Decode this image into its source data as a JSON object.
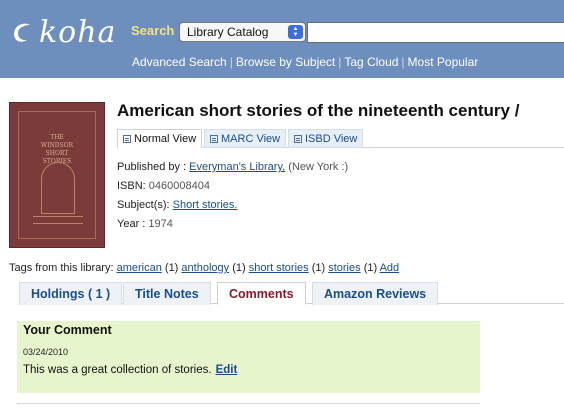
{
  "header": {
    "logo_text": "koha",
    "search_label": "Search",
    "catalog_selected": "Library Catalog",
    "search_value": "",
    "links": [
      {
        "label": "Advanced Search"
      },
      {
        "label": "Browse by Subject"
      },
      {
        "label": "Tag Cloud"
      },
      {
        "label": "Most Popular"
      }
    ],
    "colors": {
      "bar": "#6e8fbd",
      "search_label": "#f2e27a"
    }
  },
  "record": {
    "title": "American short stories of the nineteenth century /",
    "cover_text_lines": [
      "THE",
      "WINDSOR",
      "SHORT",
      "STORIES"
    ],
    "view_tabs": [
      {
        "label": "Normal View",
        "active": true
      },
      {
        "label": "MARC View",
        "active": false
      },
      {
        "label": "ISBD View",
        "active": false
      }
    ],
    "published_label": "Published by :",
    "publisher": "Everyman's Library,",
    "place": "(New York :)",
    "isbn_label": "ISBN:",
    "isbn": "0460008404",
    "subjects_label": "Subject(s):",
    "subject": "Short stories.",
    "year_label": "Year :",
    "year": "1974"
  },
  "tags": {
    "intro": "Tags from this library:",
    "items": [
      {
        "name": "american",
        "count": "(1)"
      },
      {
        "name": "anthology",
        "count": "(1)"
      },
      {
        "name": "short stories",
        "count": "(1)"
      },
      {
        "name": "stories",
        "count": "(1)"
      }
    ],
    "add_label": "Add"
  },
  "lower_tabs": [
    {
      "label": "Holdings ( 1 )",
      "active": false
    },
    {
      "label": "Title Notes",
      "active": false
    },
    {
      "label": "Comments",
      "active": true
    },
    {
      "label": "Amazon Reviews",
      "active": false
    }
  ],
  "comment": {
    "heading": "Your Comment",
    "date": "03/24/2010",
    "text": "This was a great collection of stories.",
    "edit_label": "Edit",
    "panel_color": "#e7f5cc"
  }
}
